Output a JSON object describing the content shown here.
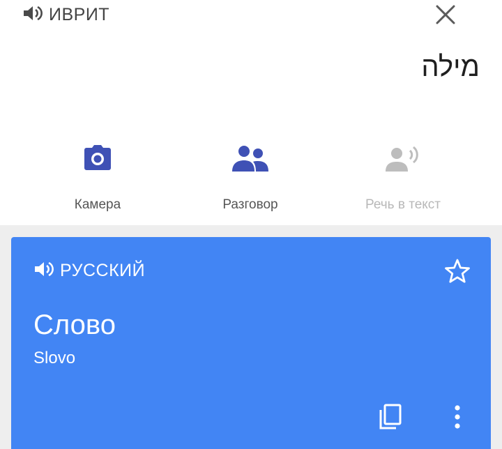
{
  "source": {
    "language": "ИВРИТ",
    "speaker_icon": "volume-icon",
    "text": "מילה"
  },
  "header": {
    "close_icon": "close-icon"
  },
  "tools": [
    {
      "label": "Камера",
      "icon": "camera-icon",
      "enabled": true
    },
    {
      "label": "Разговор",
      "icon": "people-icon",
      "enabled": true
    },
    {
      "label": "Речь в текст",
      "icon": "voice-person-icon",
      "enabled": false
    }
  ],
  "result": {
    "language": "РУССКИЙ",
    "speaker_icon": "volume-icon",
    "favorite_icon": "star-outline-icon",
    "text": "Слово",
    "transliteration": "Slovo",
    "copy_icon": "copy-icon",
    "more_icon": "more-vert-icon"
  },
  "colors": {
    "accent": "#4285f4",
    "tool_icon": "#3f51b5",
    "disabled": "#b8b8b8",
    "separator": "#eeeeee"
  }
}
